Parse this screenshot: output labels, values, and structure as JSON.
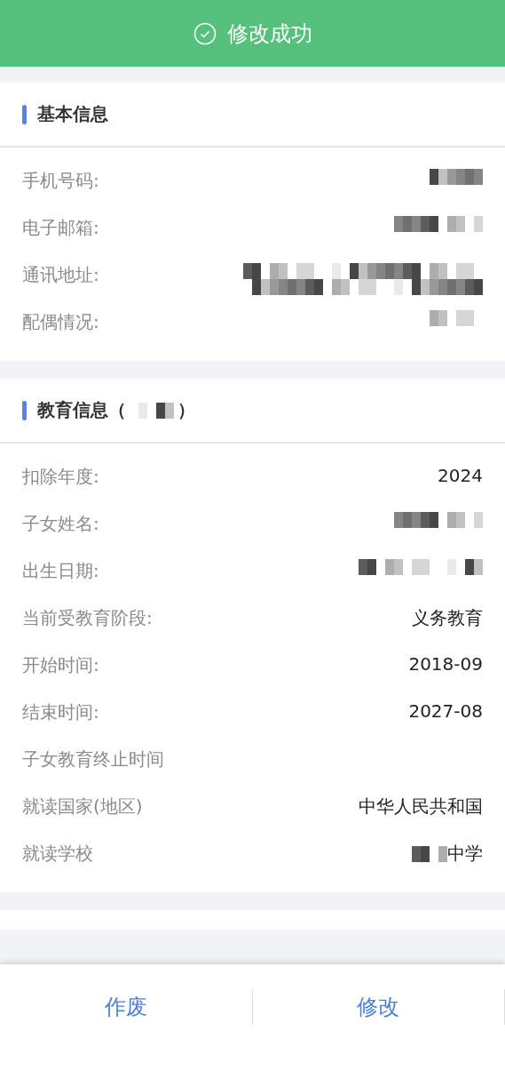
{
  "toast": {
    "text": "修改成功"
  },
  "sections": [
    {
      "title": "基本信息",
      "title_masked": false,
      "rows": [
        {
          "label": "手机号码:",
          "kind": "masked"
        },
        {
          "label": "电子邮箱:",
          "kind": "masked"
        },
        {
          "label": "通讯地址:",
          "kind": "masked_multiline"
        },
        {
          "label": "配偶情况:",
          "kind": "masked"
        }
      ]
    },
    {
      "title": "教育信息（",
      "title_masked": true,
      "title_end": "）",
      "rows": [
        {
          "label": "扣除年度:",
          "kind": "text",
          "value": "2024"
        },
        {
          "label": "子女姓名:",
          "kind": "masked"
        },
        {
          "label": "出生日期:",
          "kind": "masked"
        },
        {
          "label": "当前受教育阶段:",
          "kind": "text",
          "value": "义务教育"
        },
        {
          "label": "开始时间:",
          "kind": "text",
          "value": "2018-09"
        },
        {
          "label": "结束时间:",
          "kind": "text",
          "value": "2027-08"
        },
        {
          "label": "子女教育终止时间",
          "kind": "blank"
        },
        {
          "label": "就读国家(地区)",
          "kind": "text",
          "value": "中华人民共和国"
        },
        {
          "label": "就读学校",
          "kind": "masked_prefix",
          "value": "中学"
        }
      ]
    }
  ],
  "footer": {
    "buttons": [
      {
        "label": "作废"
      },
      {
        "label": "修改"
      }
    ]
  }
}
